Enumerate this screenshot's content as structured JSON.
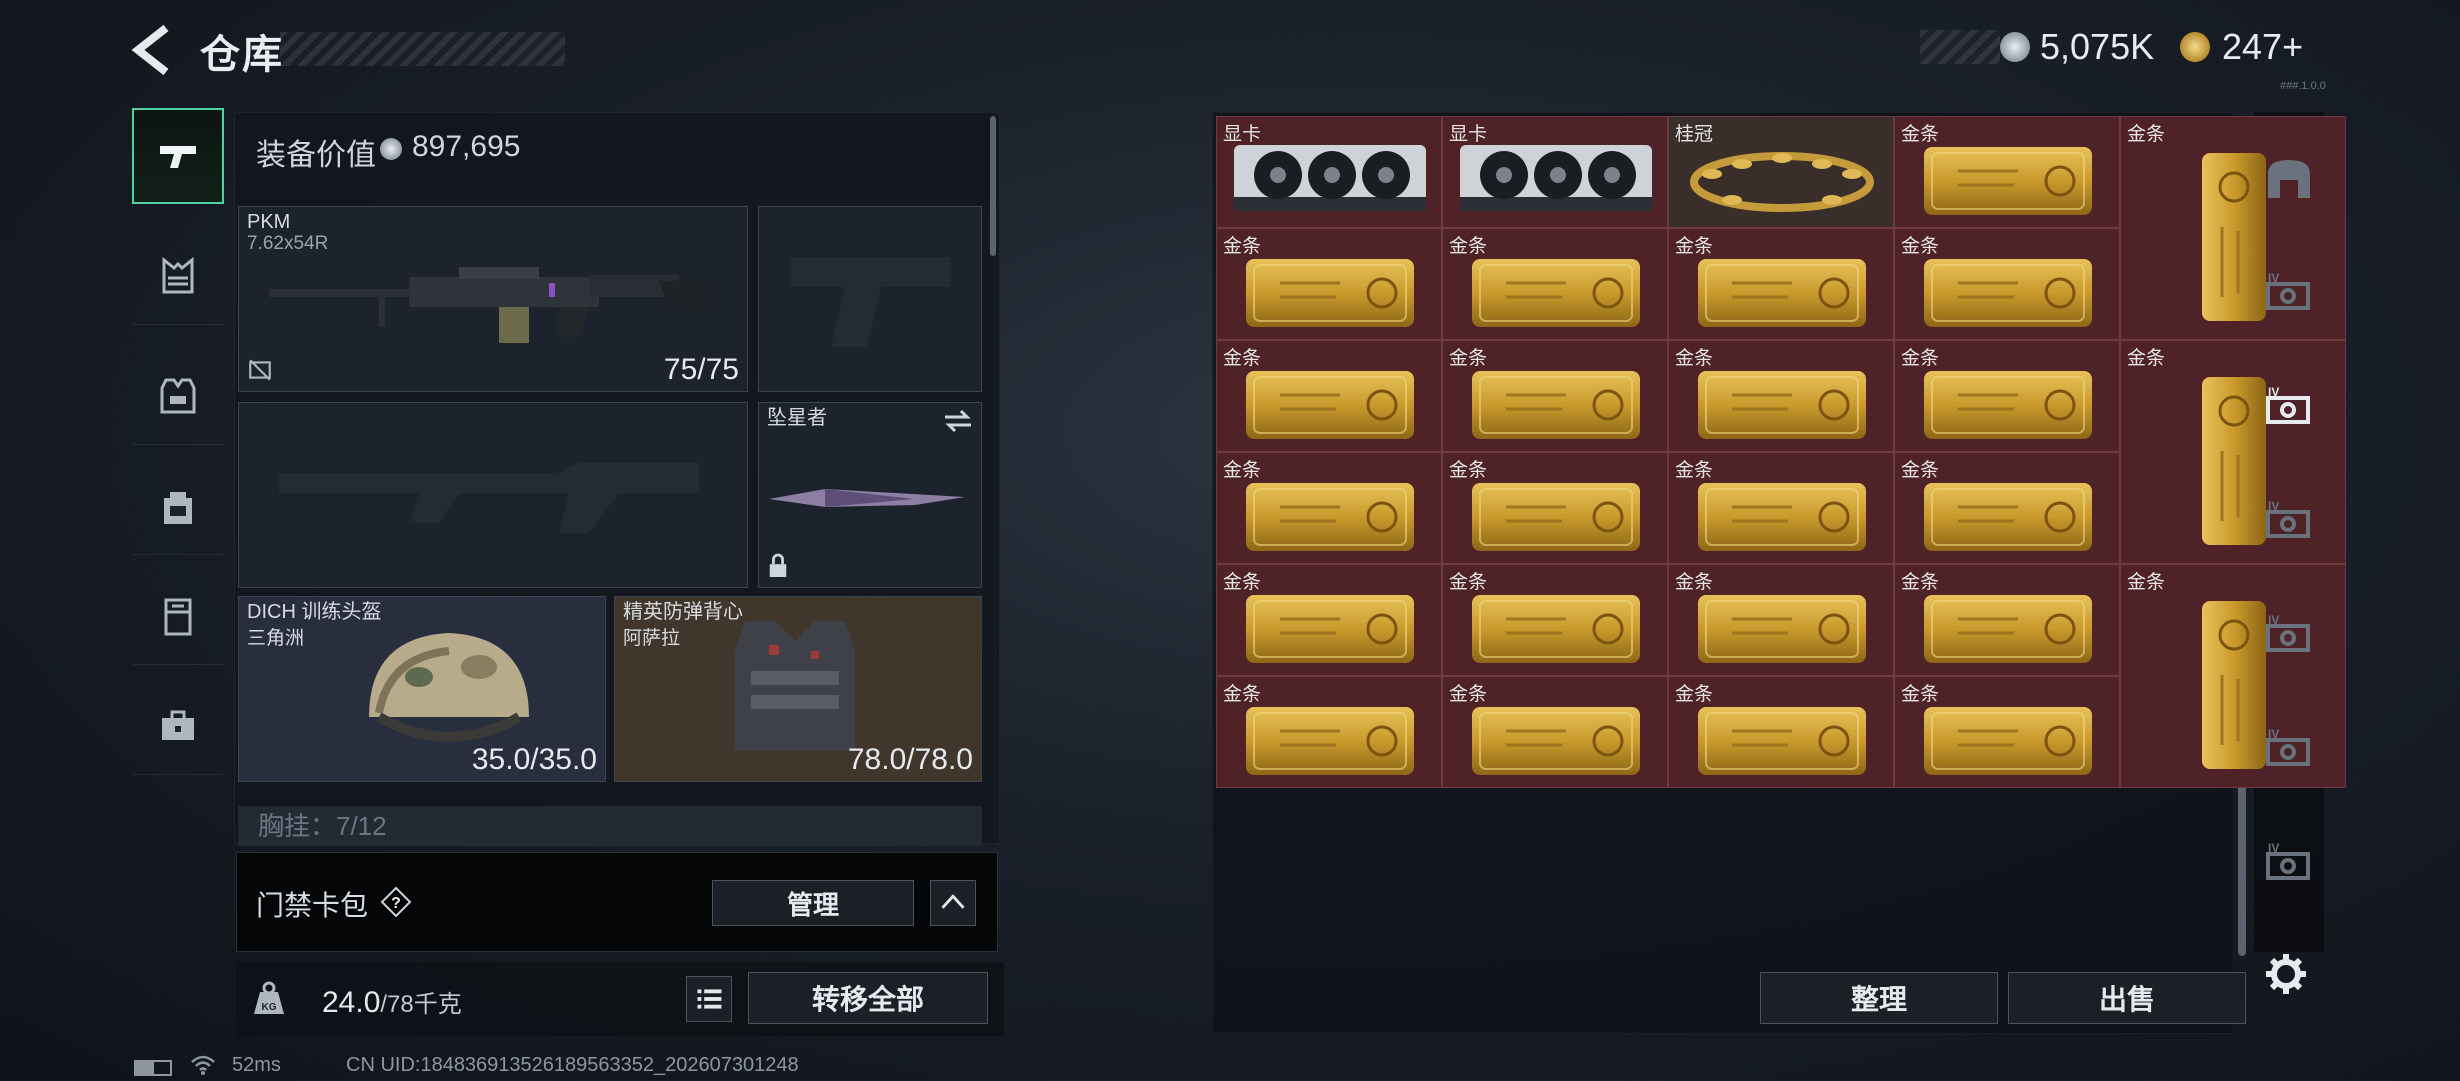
{
  "header": {
    "title": "仓库",
    "currency": [
      {
        "icon": "silver-coin-icon",
        "value": "5,075K"
      },
      {
        "icon": "gold-coin-icon",
        "value": "247+"
      }
    ],
    "version": "###.1.0.0"
  },
  "left_rail": {
    "items": [
      {
        "icon": "pistol-icon",
        "active": true
      },
      {
        "icon": "chest-rig-icon"
      },
      {
        "icon": "armor-vest-icon"
      },
      {
        "icon": "backpack-icon"
      },
      {
        "icon": "case-icon"
      },
      {
        "icon": "toolbox-icon"
      }
    ]
  },
  "loadout": {
    "equipment_value_label": "装备价值",
    "equipment_value": "897,695",
    "primary": {
      "name": "PKM",
      "ammo": "7.62x54R",
      "durability": "75/75"
    },
    "melee": {
      "name": "坠星者"
    },
    "helmet": {
      "name": "DICH 训练头盔",
      "sub": "三角洲",
      "durability": "35.0/35.0"
    },
    "armor": {
      "name": "精英防弹背心",
      "sub": "阿萨拉",
      "durability": "78.0/78.0"
    },
    "chest_rig": "胸挂：7/12"
  },
  "keycard": {
    "label": "门禁卡包",
    "manage_label": "管理"
  },
  "weight": {
    "current": "24.0",
    "max": "/78千克",
    "transfer_label": "转移全部"
  },
  "status": {
    "ping": "52ms",
    "uid": "CN UID:18483691352618956335​2_202607301248"
  },
  "stash": {
    "items": [
      {
        "name": "显卡",
        "type": "gpu"
      },
      {
        "name": "显卡",
        "type": "gpu"
      },
      {
        "name": "桂冠",
        "type": "laurel"
      },
      {
        "name": "金条",
        "type": "gold"
      },
      {
        "name": "金条",
        "type": "gold-v"
      },
      {
        "name": "金条",
        "type": "gold"
      },
      {
        "name": "金条",
        "type": "gold"
      },
      {
        "name": "金条",
        "type": "gold"
      },
      {
        "name": "金条",
        "type": "gold"
      },
      {
        "name": "金条",
        "type": "gold"
      },
      {
        "name": "金条",
        "type": "gold"
      },
      {
        "name": "金条",
        "type": "gold"
      },
      {
        "name": "金条",
        "type": "gold"
      },
      {
        "name": "金条",
        "type": "gold-v"
      },
      {
        "name": "金条",
        "type": "gold"
      },
      {
        "name": "金条",
        "type": "gold"
      },
      {
        "name": "金条",
        "type": "gold"
      },
      {
        "name": "金条",
        "type": "gold"
      },
      {
        "name": "金条",
        "type": "gold"
      },
      {
        "name": "金条",
        "type": "gold"
      },
      {
        "name": "金条",
        "type": "gold"
      },
      {
        "name": "金条",
        "type": "gold"
      },
      {
        "name": "金条",
        "type": "gold-v"
      },
      {
        "name": "金条",
        "type": "gold"
      },
      {
        "name": "金条",
        "type": "gold"
      },
      {
        "name": "金条",
        "type": "gold"
      },
      {
        "name": "金条",
        "type": "gold"
      }
    ],
    "sort_label": "整理",
    "sell_label": "出售"
  },
  "right_rail": {
    "items": [
      "home-icon",
      "case-tier4-icon",
      "case-tier4-icon",
      "case-tier4-icon",
      "case-tier4-icon",
      "case-tier4-icon",
      "case-tier4-icon"
    ]
  },
  "colors": {
    "accent": "#4fd1a0",
    "stash_cell": "#4e2226",
    "gold": "#c9a13b"
  }
}
